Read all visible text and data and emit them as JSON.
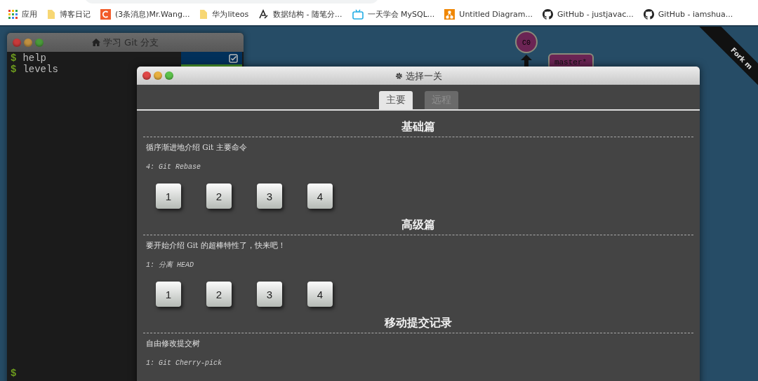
{
  "browser": {
    "bookmarks": [
      {
        "label": "应用",
        "kind": "apps"
      },
      {
        "label": "博客日记",
        "kind": "folder"
      },
      {
        "label": "(3条消息)Mr.Wang...",
        "kind": "csdn"
      },
      {
        "label": "华为liteos",
        "kind": "folder"
      },
      {
        "label": "数据结构 - 随笔分...",
        "kind": "logo"
      },
      {
        "label": "一天学会 MySQL...",
        "kind": "tv"
      },
      {
        "label": "Untitled Diagram...",
        "kind": "diagram"
      },
      {
        "label": "GitHub - justjavac...",
        "kind": "github"
      },
      {
        "label": "GitHub - iamshua...",
        "kind": "github"
      }
    ]
  },
  "terminal": {
    "title": "学习 Git 分支",
    "lines": [
      {
        "prompt": "$",
        "command": "help"
      },
      {
        "prompt": "$",
        "command": "levels"
      }
    ],
    "bottom_prompt": "$"
  },
  "graph": {
    "commit": "C0",
    "branch": "master*"
  },
  "ribbon": "Fork m",
  "dialog": {
    "title": "选择一关",
    "tabs": [
      {
        "label": "主要",
        "selected": true
      },
      {
        "label": "远程",
        "selected": false
      }
    ],
    "sections": [
      {
        "title": "基础篇",
        "description": "循序渐进地介绍 Git 主要命令",
        "current": "4: Git Rebase",
        "levels": [
          "1",
          "2",
          "3",
          "4"
        ]
      },
      {
        "title": "高级篇",
        "description": "要开始介绍 Git 的超棒特性了，快来吧！",
        "current": "1: 分离 HEAD",
        "levels": [
          "1",
          "2",
          "3",
          "4"
        ]
      },
      {
        "title": "移动提交记录",
        "description": "自由修改提交树",
        "current": "1: Git Cherry-pick"
      }
    ]
  }
}
